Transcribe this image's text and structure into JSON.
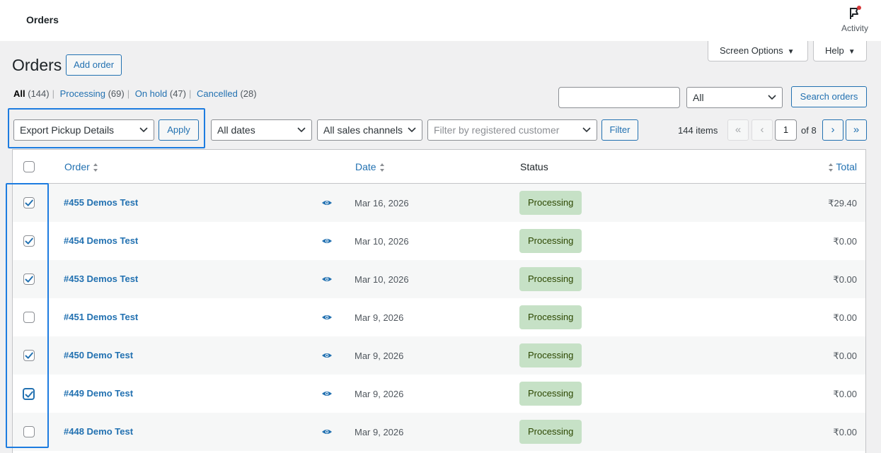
{
  "topbar": {
    "title": "Orders",
    "activity_label": "Activity"
  },
  "screen_options": {
    "screen_options_label": "Screen Options",
    "help_label": "Help"
  },
  "page": {
    "title": "Orders",
    "add_order_label": "Add order"
  },
  "filters_links": [
    {
      "label": "All",
      "count": "(144)"
    },
    {
      "label": "Processing",
      "count": "(69)"
    },
    {
      "label": "On hold",
      "count": "(47)"
    },
    {
      "label": "Cancelled",
      "count": "(28)"
    }
  ],
  "search": {
    "value": "",
    "status_select": "All",
    "button_label": "Search orders"
  },
  "bulk": {
    "action_selected": "Export Pickup Details",
    "apply_label": "Apply"
  },
  "filters": {
    "dates": "All dates",
    "channels": "All sales channels",
    "customer_placeholder": "Filter by registered customer",
    "filter_label": "Filter"
  },
  "pagination": {
    "items": "144 items",
    "first": "«",
    "prev": "‹",
    "next": "›",
    "last": "»",
    "current_page": "1",
    "of_pages": "of 8"
  },
  "table": {
    "headers": {
      "order": "Order",
      "date": "Date",
      "status": "Status",
      "total": "Total"
    },
    "rows": [
      {
        "order": "#455 Demos Test",
        "date": "Mar 16, 2026",
        "status": "Processing",
        "total": "₹29.40",
        "checked": true
      },
      {
        "order": "#454 Demos Test",
        "date": "Mar 10, 2026",
        "status": "Processing",
        "total": "₹0.00",
        "checked": true
      },
      {
        "order": "#453 Demos Test",
        "date": "Mar 10, 2026",
        "status": "Processing",
        "total": "₹0.00",
        "checked": true
      },
      {
        "order": "#451 Demos Test",
        "date": "Mar 9, 2026",
        "status": "Processing",
        "total": "₹0.00",
        "checked": false
      },
      {
        "order": "#450 Demo Test",
        "date": "Mar 9, 2026",
        "status": "Processing",
        "total": "₹0.00",
        "checked": true
      },
      {
        "order": "#449 Demo Test",
        "date": "Mar 9, 2026",
        "status": "Processing",
        "total": "₹0.00",
        "checked": true
      },
      {
        "order": "#448 Demo Test",
        "date": "Mar 9, 2026",
        "status": "Processing",
        "total": "₹0.00",
        "checked": false
      }
    ]
  },
  "colors": {
    "accent": "#2271b1",
    "highlight": "#1d7ce0",
    "status_processing_bg": "#c6e1c6",
    "status_processing_text": "#2c4700"
  }
}
